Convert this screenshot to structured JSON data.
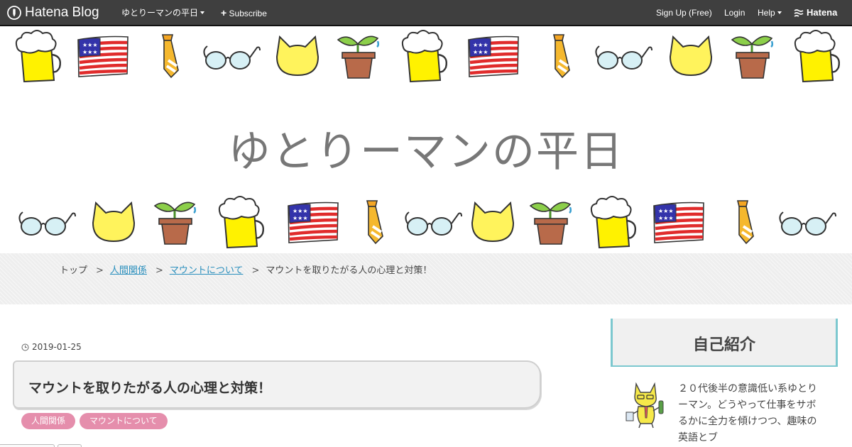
{
  "topbar": {
    "logo_text": "Hatena Blog",
    "blog_menu": "ゆとりーマンの平日",
    "subscribe": "Subscribe",
    "signup": "Sign Up (Free)",
    "login": "Login",
    "help": "Help",
    "brand": "Hatena"
  },
  "header": {
    "title": "ゆとりーマンの平日",
    "motifs_top": [
      "beer-mug",
      "us-flag",
      "necktie",
      "glasses",
      "cat-face",
      "potted-plant",
      "beer-mug",
      "us-flag",
      "necktie",
      "glasses",
      "cat-face",
      "potted-plant",
      "beer-mug"
    ],
    "motifs_bottom": [
      "glasses",
      "cat-face",
      "potted-plant",
      "beer-mug",
      "us-flag",
      "necktie",
      "glasses",
      "cat-face",
      "potted-plant",
      "beer-mug",
      "us-flag",
      "necktie",
      "glasses"
    ]
  },
  "breadcrumb": {
    "top": "トップ",
    "sep": ">",
    "category": "人間関係",
    "subcategory": "マウントについて",
    "current": "マウントを取りたがる人の心理と対策！"
  },
  "article": {
    "date": "2019-01-25",
    "title": "マウントを取りたがる人の心理と対策！",
    "tags": [
      "人間関係",
      "マウントについて"
    ]
  },
  "sidebar": {
    "profile_heading": "自己紹介",
    "profile_text": "２０代後半の意識低い系ゆとりーマン。どうやって仕事をサボるかに全力を傾けつつ、趣味の英語とブ"
  },
  "colors": {
    "topbar": "#3f3f3f",
    "accent_teal": "#7cc8cf",
    "tag_pink": "#e58eac",
    "link_blue": "#2a8fbd",
    "title_gray": "#777777"
  }
}
